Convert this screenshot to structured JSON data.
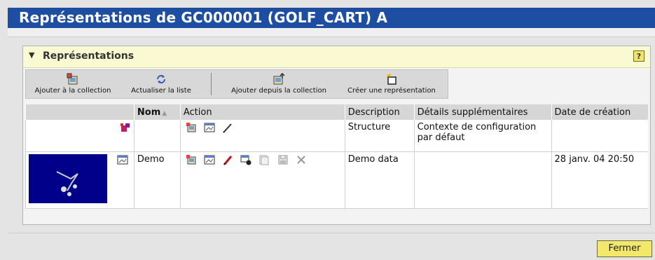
{
  "window": {
    "title": "Représentations de GC000001 (GOLF_CART) A"
  },
  "panel": {
    "title": "Représentations",
    "help": "?"
  },
  "toolbar": {
    "add_to_collection": "Ajouter à la collection",
    "refresh_list": "Actualiser la liste",
    "add_from_collection": "Ajouter depuis la collection",
    "create_representation": "Créer une représentation"
  },
  "table": {
    "headers": {
      "name": "Nom",
      "action": "Action",
      "description": "Description",
      "details": "Détails supplémentaires",
      "created": "Date de création"
    },
    "rows": [
      {
        "name": "",
        "description": "Structure",
        "details": "Contexte de configuration par défaut",
        "created": ""
      },
      {
        "name": "Demo",
        "description": "Demo data",
        "details": "",
        "created": "28 janv. 04 20:50"
      }
    ]
  },
  "footer": {
    "close": "Fermer"
  },
  "colors": {
    "title_bar": "#1d4ea1",
    "panel_header": "#fafad2",
    "button": "#f3e86a",
    "thumbnail": "#00008b"
  }
}
